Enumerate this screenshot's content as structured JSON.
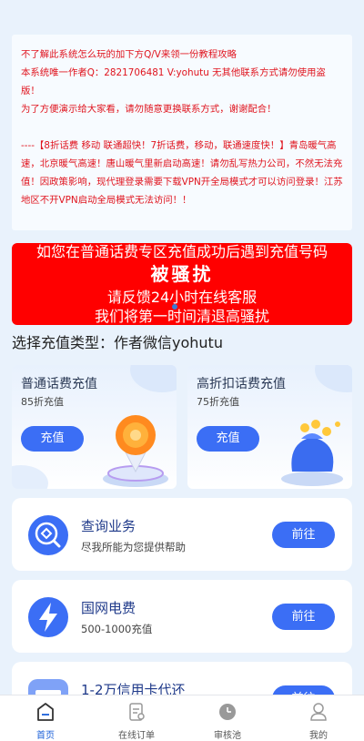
{
  "notice": {
    "line1": "不了解此系统怎么玩的加下方Q/V来领一份教程攻略",
    "line2": "本系统唯一作者Q：2821706481 V:yohutu 无其他联系方式请勿使用盗版！",
    "line3": "为了方便演示给大家看，请勿随意更换联系方式，谢谢配合！",
    "line4": "----【8折话费 移动 联通超快！7折话费，移动，联通速度快！】青岛暖气高速，北京暖气高速！唐山暖气里新启动高速！请勿乱写热力公司，不然无法充值！因政策影响，现代理登录需要下载VPN开全局模式才可以访问登录！江苏地区不开VPN启动全局模式无法访问！！"
  },
  "banner": {
    "line1": "如您在普通话费专区充值成功后遇到充值号码",
    "line2": "被骚扰",
    "line3": "请反馈24小时在线客服",
    "line4": "我们将第一时间清退高骚扰"
  },
  "section_title": "选择充值类型：作者微信yohutu",
  "cards": [
    {
      "title": "普通话费充值",
      "sub": "85折充值",
      "button": "充值"
    },
    {
      "title": "高折扣话费充值",
      "sub": "75折充值",
      "button": "充值"
    }
  ],
  "services": [
    {
      "name": "查询业务",
      "desc": "尽我所能为您提供帮助",
      "button": "前往",
      "icon": "search-icon"
    },
    {
      "name": "国网电费",
      "desc": "500-1000充值",
      "button": "前往",
      "icon": "lightning-icon"
    },
    {
      "name": "1-2万信用卡代还",
      "desc": "",
      "button": "前往",
      "icon": "card-icon"
    }
  ],
  "tabs": [
    {
      "label": "首页",
      "icon": "home-icon",
      "active": true
    },
    {
      "label": "在线订单",
      "icon": "order-icon",
      "active": false
    },
    {
      "label": "审核池",
      "icon": "clock-icon",
      "active": false
    },
    {
      "label": "我的",
      "icon": "user-icon",
      "active": false
    }
  ],
  "colors": {
    "accent": "#3b6ef5",
    "banner": "#ff0000",
    "notice_text": "#e0141e",
    "background": "#e9f2fc"
  }
}
